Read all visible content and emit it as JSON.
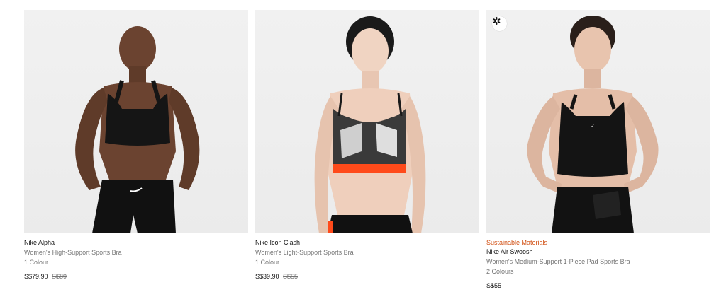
{
  "products": [
    {
      "name": "Nike Alpha",
      "subtitle": "Women's High-Support Sports Bra",
      "colours": "1 Colour",
      "price": "S$79.90",
      "original_price": "S$89"
    },
    {
      "name": "Nike Icon Clash",
      "subtitle": "Women's Light-Support Sports Bra",
      "colours": "1 Colour",
      "price": "S$39.90",
      "original_price": "S$55"
    },
    {
      "name": "Nike Air Swoosh",
      "tag": "Sustainable Materials",
      "subtitle": "Women's Medium-Support 1-Piece Pad Sports Bra",
      "colours": "2 Colours",
      "price": "S$55",
      "badge_icon": "sustainability-icon"
    }
  ],
  "colors": {
    "tag": "#d14f12",
    "muted": "#757575",
    "image_bg": "#eeeeee"
  }
}
